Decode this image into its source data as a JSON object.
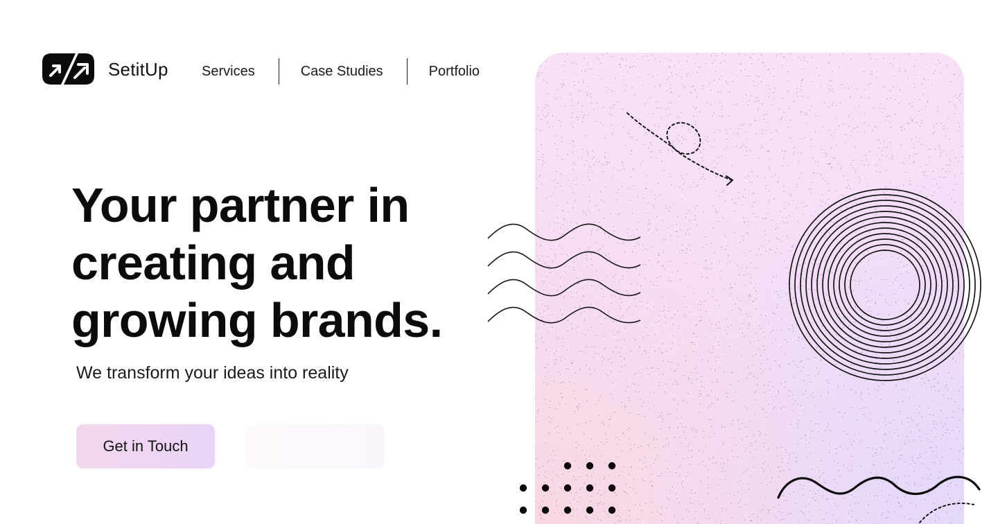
{
  "brand": {
    "name": "SetitUp",
    "logo_icon": "setitup-logo-icon"
  },
  "nav": {
    "items": [
      {
        "label": "Services"
      },
      {
        "label": "Case Studies"
      },
      {
        "label": "Portfolio"
      }
    ]
  },
  "hero": {
    "title_lines": [
      "Your partner in",
      "creating and",
      "growing brands."
    ],
    "subtitle": "We transform your ideas into reality",
    "primary_cta": "Get in Touch",
    "secondary_cta": ""
  },
  "colors": {
    "text": "#0b0b0b",
    "panel_top": "#f7e0f8",
    "panel_bottom_left": "#fad7e2",
    "panel_bottom_right": "#e2d7fc",
    "cta_start": "#f2d7ec",
    "cta_end": "#e9d4f8"
  },
  "decorations": {
    "icons": [
      "dashed-loop-arrow-icon",
      "wave-lines-icon",
      "concentric-circles-icon",
      "dot-grid-icon",
      "squiggle-line-icon"
    ]
  }
}
